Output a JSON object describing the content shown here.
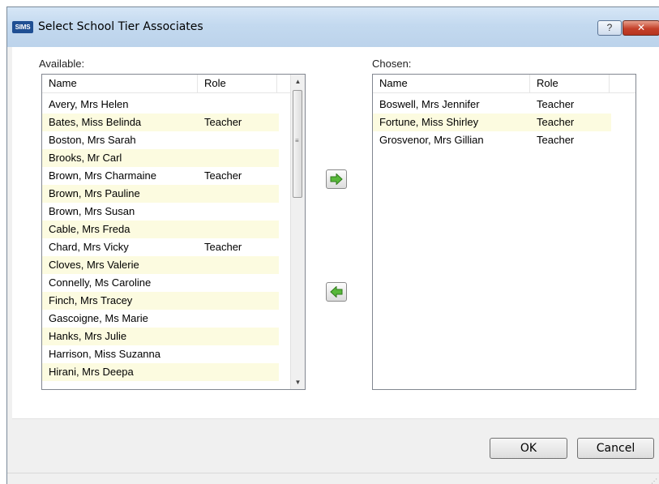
{
  "window": {
    "app_icon_text": "SIMS",
    "title": "Select School Tier Associates",
    "help_label": "?",
    "close_label": "✕"
  },
  "available": {
    "label": "Available:",
    "columns": [
      "Name",
      "Role"
    ],
    "rows": [
      {
        "name": "Avery, Mrs Helen",
        "role": ""
      },
      {
        "name": "Bates, Miss Belinda",
        "role": "Teacher"
      },
      {
        "name": "Boston, Mrs Sarah",
        "role": ""
      },
      {
        "name": "Brooks, Mr Carl",
        "role": ""
      },
      {
        "name": "Brown, Mrs Charmaine",
        "role": "Teacher"
      },
      {
        "name": "Brown, Mrs Pauline",
        "role": ""
      },
      {
        "name": "Brown, Mrs Susan",
        "role": ""
      },
      {
        "name": "Cable, Mrs Freda",
        "role": ""
      },
      {
        "name": "Chard, Mrs Vicky",
        "role": "Teacher"
      },
      {
        "name": "Cloves, Mrs Valerie",
        "role": ""
      },
      {
        "name": "Connelly, Ms Caroline",
        "role": ""
      },
      {
        "name": "Finch, Mrs Tracey",
        "role": ""
      },
      {
        "name": "Gascoigne, Ms Marie",
        "role": ""
      },
      {
        "name": "Hanks, Mrs Julie",
        "role": ""
      },
      {
        "name": "Harrison, Miss Suzanna",
        "role": ""
      },
      {
        "name": "Hirani, Mrs Deepa",
        "role": ""
      }
    ]
  },
  "chosen": {
    "label": "Chosen:",
    "columns": [
      "Name",
      "Role"
    ],
    "rows": [
      {
        "name": "Boswell, Mrs Jennifer",
        "role": "Teacher"
      },
      {
        "name": "Fortune, Miss Shirley",
        "role": "Teacher"
      },
      {
        "name": "Grosvenor, Mrs Gillian",
        "role": "Teacher"
      }
    ]
  },
  "buttons": {
    "ok": "OK",
    "cancel": "Cancel"
  },
  "colors": {
    "alt_row": "#fcfbe0",
    "arrow_green": "#58b83a"
  }
}
